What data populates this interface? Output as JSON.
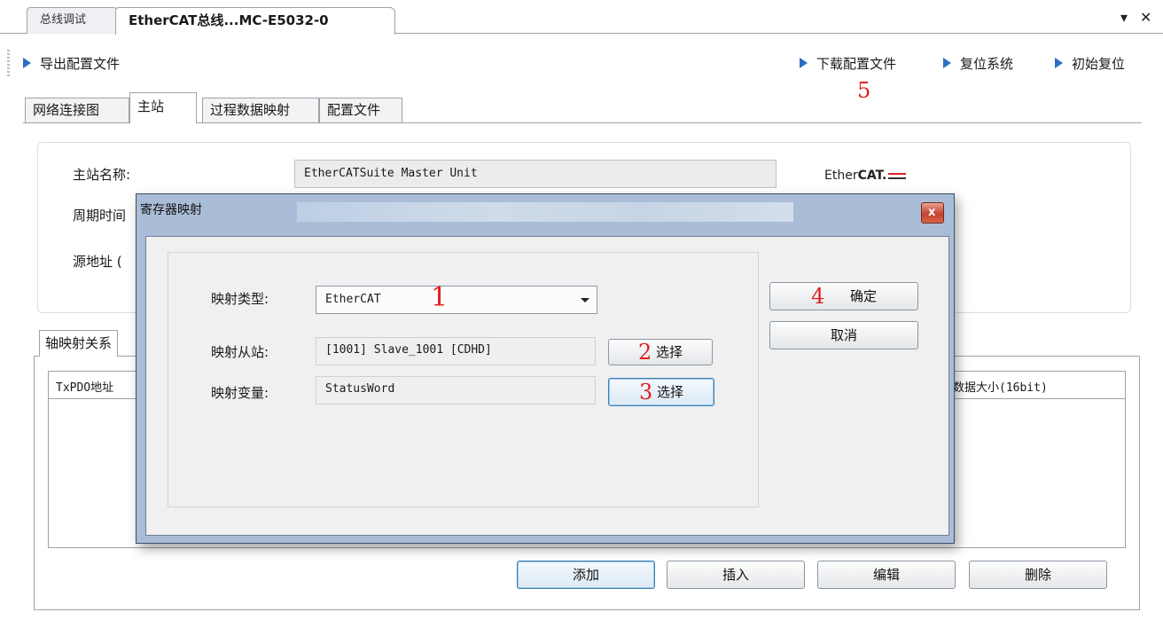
{
  "doc_tabs": [
    {
      "label": "总线调试"
    },
    {
      "label": "EtherCAT总线...MC-E5032-0"
    }
  ],
  "window_controls": {
    "dropdown": "▾",
    "close": "✕"
  },
  "toolbar": {
    "export": "导出配置文件",
    "download": "下载配置文件",
    "reset_system": "复位系统",
    "initial_reset": "初始复位"
  },
  "annotations": {
    "a1": "1",
    "a2": "2",
    "a3": "3",
    "a4": "4",
    "a5": "5"
  },
  "inner_tabs": [
    {
      "label": "网络连接图"
    },
    {
      "label": "主站"
    },
    {
      "label": "过程数据映射"
    },
    {
      "label": "配置文件"
    }
  ],
  "master": {
    "name_label": "主站名称:",
    "name_value": "EtherCATSuite Master Unit",
    "cycle_label": "周期时间",
    "source_label": "源地址 (",
    "logo_prefix": "Ether",
    "logo_bold": "CAT."
  },
  "axis": {
    "tab_label": "轴映射关系",
    "col_first": "TxPDO地址",
    "col_last": "数据大小(16bit)"
  },
  "bottom_buttons": {
    "add": "添加",
    "insert": "插入",
    "edit": "编辑",
    "delete": "删除"
  },
  "dialog": {
    "title": "寄存器映射",
    "close_glyph": "x",
    "type_label": "映射类型:",
    "type_value": "EtherCAT",
    "slave_label": "映射从站:",
    "slave_value": "[1001] Slave_1001 [CDHD]",
    "var_label": "映射变量:",
    "var_value": "StatusWord",
    "select1": "选择",
    "select2": "选择",
    "ok": "确定",
    "cancel": "取消"
  }
}
